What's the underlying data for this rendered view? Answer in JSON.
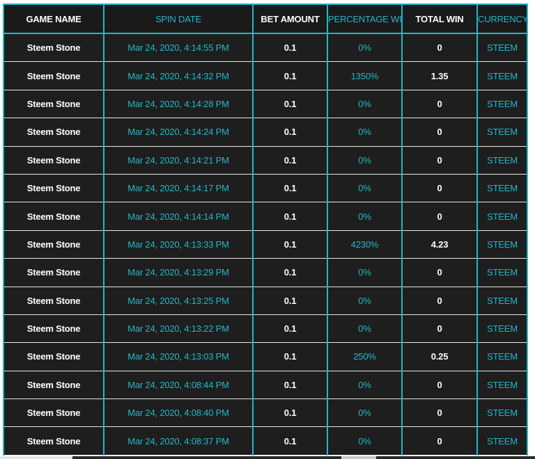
{
  "table": {
    "columns": [
      {
        "label": "GAME NAME"
      },
      {
        "label": "SPIN DATE"
      },
      {
        "label": "BET AMOUNT"
      },
      {
        "label": "PERCENTAGE WIN"
      },
      {
        "label": "TOTAL WIN"
      },
      {
        "label": "CURRENCY"
      }
    ],
    "rows": [
      {
        "game": "Steem Stone",
        "date": "Mar 24, 2020, 4:14:55 PM",
        "bet": "0.1",
        "pct": "0%",
        "total": "0",
        "currency": "STEEM"
      },
      {
        "game": "Steem Stone",
        "date": "Mar 24, 2020, 4:14:32 PM",
        "bet": "0.1",
        "pct": "1350%",
        "total": "1.35",
        "currency": "STEEM"
      },
      {
        "game": "Steem Stone",
        "date": "Mar 24, 2020, 4:14:28 PM",
        "bet": "0.1",
        "pct": "0%",
        "total": "0",
        "currency": "STEEM"
      },
      {
        "game": "Steem Stone",
        "date": "Mar 24, 2020, 4:14:24 PM",
        "bet": "0.1",
        "pct": "0%",
        "total": "0",
        "currency": "STEEM"
      },
      {
        "game": "Steem Stone",
        "date": "Mar 24, 2020, 4:14:21 PM",
        "bet": "0.1",
        "pct": "0%",
        "total": "0",
        "currency": "STEEM"
      },
      {
        "game": "Steem Stone",
        "date": "Mar 24, 2020, 4:14:17 PM",
        "bet": "0.1",
        "pct": "0%",
        "total": "0",
        "currency": "STEEM"
      },
      {
        "game": "Steem Stone",
        "date": "Mar 24, 2020, 4:14:14 PM",
        "bet": "0.1",
        "pct": "0%",
        "total": "0",
        "currency": "STEEM"
      },
      {
        "game": "Steem Stone",
        "date": "Mar 24, 2020, 4:13:33 PM",
        "bet": "0.1",
        "pct": "4230%",
        "total": "4.23",
        "currency": "STEEM"
      },
      {
        "game": "Steem Stone",
        "date": "Mar 24, 2020, 4:13:29 PM",
        "bet": "0.1",
        "pct": "0%",
        "total": "0",
        "currency": "STEEM"
      },
      {
        "game": "Steem Stone",
        "date": "Mar 24, 2020, 4:13:25 PM",
        "bet": "0.1",
        "pct": "0%",
        "total": "0",
        "currency": "STEEM"
      },
      {
        "game": "Steem Stone",
        "date": "Mar 24, 2020, 4:13:22 PM",
        "bet": "0.1",
        "pct": "0%",
        "total": "0",
        "currency": "STEEM"
      },
      {
        "game": "Steem Stone",
        "date": "Mar 24, 2020, 4:13:03 PM",
        "bet": "0.1",
        "pct": "250%",
        "total": "0.25",
        "currency": "STEEM"
      },
      {
        "game": "Steem Stone",
        "date": "Mar 24, 2020, 4:08:44 PM",
        "bet": "0.1",
        "pct": "0%",
        "total": "0",
        "currency": "STEEM"
      },
      {
        "game": "Steem Stone",
        "date": "Mar 24, 2020, 4:08:40 PM",
        "bet": "0.1",
        "pct": "0%",
        "total": "0",
        "currency": "STEEM"
      },
      {
        "game": "Steem Stone",
        "date": "Mar 24, 2020, 4:08:37 PM",
        "bet": "0.1",
        "pct": "0%",
        "total": "0",
        "currency": "STEEM"
      }
    ]
  },
  "colors": {
    "accent": "#22b8c7",
    "background": "#1e1e1e",
    "text": "#ffffff",
    "row_divider": "#e8e8e8"
  }
}
